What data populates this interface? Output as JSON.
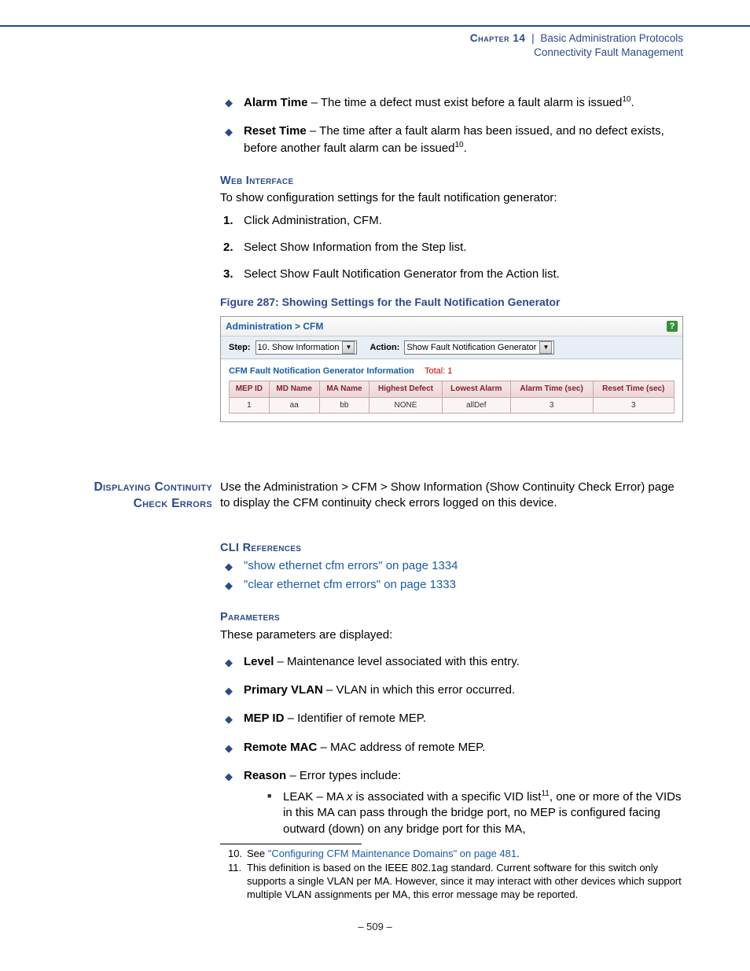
{
  "header": {
    "chapter": "Chapter 14",
    "separator": "|",
    "title": "Basic Administration Protocols",
    "subtitle": "Connectivity Fault Management"
  },
  "top_bullets": [
    {
      "label": "Alarm Time",
      "desc": " – The time a defect must exist before a fault alarm is issued",
      "sup": "10",
      "tail": "."
    },
    {
      "label": "Reset Time",
      "desc": " – The time after a fault alarm has been issued, and no defect exists, before another fault alarm can be issued",
      "sup": "10",
      "tail": "."
    }
  ],
  "web_if_heading": "Web Interface",
  "web_if_intro": "To show configuration settings for the fault notification generator:",
  "steps": [
    "Click Administration, CFM.",
    "Select Show Information from the Step list.",
    "Select Show Fault Notification Generator from the Action list."
  ],
  "figure_caption": "Figure 287:  Showing Settings for the Fault Notification Generator",
  "screenshot": {
    "breadcrumb": "Administration > CFM",
    "help": "?",
    "step_label": "Step:",
    "step_value": "10. Show Information",
    "action_label": "Action:",
    "action_value": "Show Fault Notification Generator",
    "sub_title": "CFM Fault Notification Generator Information",
    "total_label": "Total: 1",
    "columns": [
      "MEP ID",
      "MD Name",
      "MA Name",
      "Highest Defect",
      "Lowest Alarm",
      "Alarm Time (sec)",
      "Reset Time (sec)"
    ],
    "row": [
      "1",
      "aa",
      "bb",
      "NONE",
      "allDef",
      "3",
      "3"
    ]
  },
  "section2": {
    "side": "Displaying Continuity Check Errors",
    "text": "Use the Administration > CFM > Show Information (Show Continuity Check Error) page to display the CFM continuity check errors logged on this device."
  },
  "cli_heading": "CLI References",
  "cli_links": [
    "\"show ethernet cfm errors\" on page 1334",
    "\"clear ethernet cfm errors\" on page 1333"
  ],
  "params_heading": "Parameters",
  "params_intro": "These parameters are displayed:",
  "params": [
    {
      "label": "Level",
      "desc": " – Maintenance level associated with this entry."
    },
    {
      "label": "Primary VLAN",
      "desc": " – VLAN in which this error occurred."
    },
    {
      "label": "MEP ID",
      "desc": " – Identifier of remote MEP."
    },
    {
      "label": "Remote MAC",
      "desc": " – MAC address of remote MEP."
    },
    {
      "label": "Reason",
      "desc": " – Error types include:"
    }
  ],
  "reason_sub": {
    "pre": "LEAK – MA ",
    "italic": "x",
    "mid": " is associated with a specific VID list",
    "sup": "11",
    "post": ", one or more of the VIDs in this MA can pass through the bridge port, no MEP is configured facing outward (down) on any bridge port for this MA,"
  },
  "footnotes": [
    {
      "num": "10.",
      "pre": "See ",
      "link": "\"Configuring CFM Maintenance Domains\" on page 481",
      "post": "."
    },
    {
      "num": "11.",
      "text": "This definition is based on the IEEE 802.1ag standard. Current software for this switch only supports a single VLAN per MA. However, since it may interact with other devices which support multiple VLAN assignments per MA, this error message may be reported."
    }
  ],
  "page_number": "–  509  –"
}
